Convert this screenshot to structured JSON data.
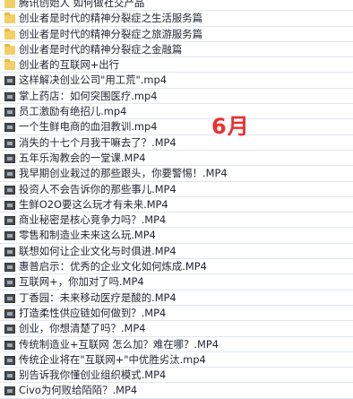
{
  "overlay": {
    "month_label": "6月"
  },
  "files": [
    {
      "name": "腾讯创始人 如何做社交产品",
      "type": "folder"
    },
    {
      "name": "创业者是时代的精神分裂症之生活服务篇",
      "type": "folder"
    },
    {
      "name": "创业者是时代的精神分裂症之旅游服务篇",
      "type": "folder"
    },
    {
      "name": "创业者是时代的精神分裂症之金融篇",
      "type": "folder"
    },
    {
      "name": "创业者的互联网+出行",
      "type": "folder"
    },
    {
      "name": "这样解决创业公司\"用工荒\".mp4",
      "type": "video"
    },
    {
      "name": "掌上药店：如何突围医疗.mp4",
      "type": "video"
    },
    {
      "name": "员工激励有绝招儿.mp4",
      "type": "video"
    },
    {
      "name": "一个生鲜电商的血泪教训.mp4",
      "type": "video"
    },
    {
      "name": "消失的十七个月我干嘛去了？.MP4",
      "type": "video"
    },
    {
      "name": "五年乐淘教会的一堂课.MP4",
      "type": "video"
    },
    {
      "name": "我早期创业栽过的那些跟头，你要警惕！.MP4",
      "type": "video"
    },
    {
      "name": "投资人不会告诉你的那些事儿.MP4",
      "type": "video"
    },
    {
      "name": "生鲜O2O要这么玩才有未来.MP4",
      "type": "video"
    },
    {
      "name": "商业秘密是核心竞争力吗？.MP4",
      "type": "video"
    },
    {
      "name": "零售和制造业未来这么玩.MP4",
      "type": "video"
    },
    {
      "name": "联想如何让企业文化与时俱进.MP4",
      "type": "video"
    },
    {
      "name": "惠普启示：优秀的企业文化如何炼成.MP4",
      "type": "video"
    },
    {
      "name": "互联网+，你加对了吗.MP4",
      "type": "video"
    },
    {
      "name": "丁香园：未来移动医疗是酸的.MP4",
      "type": "video"
    },
    {
      "name": "打造柔性供应链如何做到？.MP4",
      "type": "video"
    },
    {
      "name": "创业，你想清楚了吗？.MP4",
      "type": "video"
    },
    {
      "name": "传统制造业+互联网 怎么加？难在哪？.MP4",
      "type": "video"
    },
    {
      "name": "传统企业将在\"互联网+\"中优胜劣汰.mp4",
      "type": "video"
    },
    {
      "name": "别告诉我你懂创业组织模式.MP4",
      "type": "video"
    },
    {
      "name": "Civo为何败给陌陌？.MP4",
      "type": "video"
    }
  ]
}
